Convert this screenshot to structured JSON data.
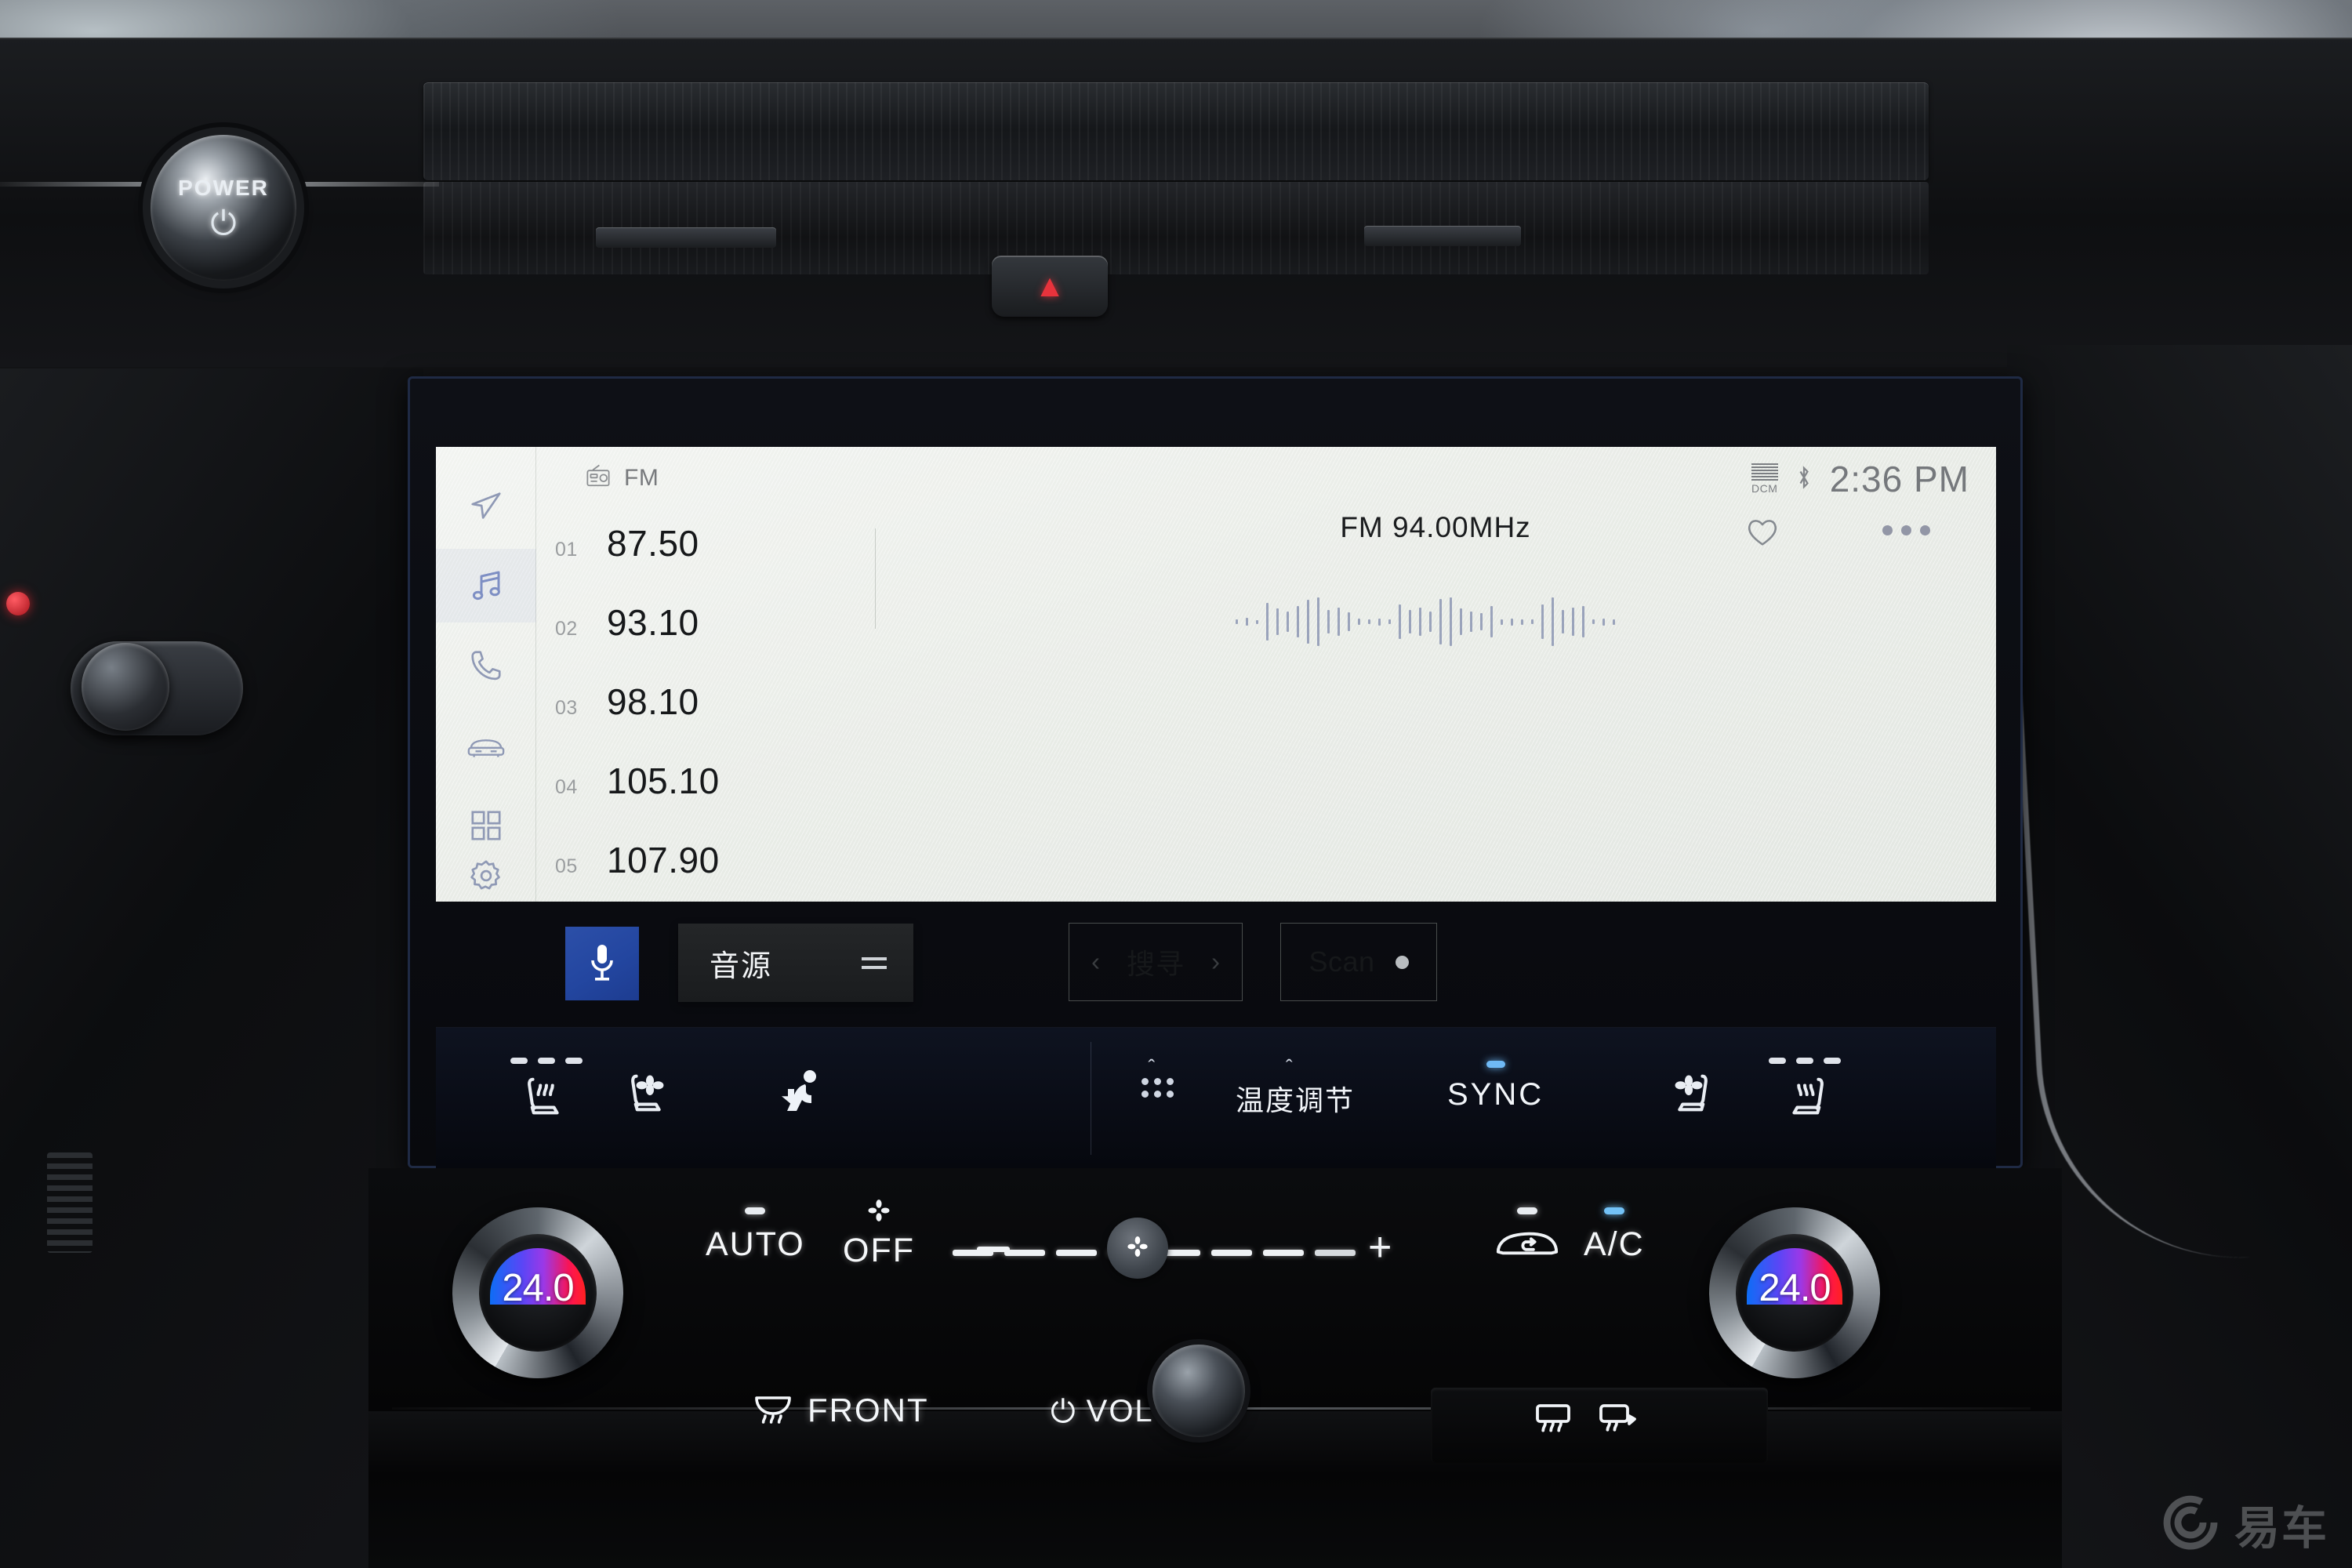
{
  "screen": {
    "statusbar": {
      "source_icon": "radio-icon",
      "source_label": "FM",
      "signal_label": "DCM",
      "bluetooth_icon": "bluetooth-icon",
      "time": "2:36 PM"
    },
    "rail": [
      {
        "name": "navigation",
        "icon": "navigation-arrow-icon",
        "active": false
      },
      {
        "name": "media",
        "icon": "music-note-icon",
        "active": true
      },
      {
        "name": "phone",
        "icon": "phone-icon",
        "active": false
      },
      {
        "name": "vehicle",
        "icon": "car-icon",
        "active": false
      },
      {
        "name": "apps",
        "icon": "apps-grid-icon",
        "active": false
      },
      {
        "name": "settings",
        "icon": "gear-icon",
        "active": false
      }
    ],
    "presets": [
      {
        "num": "01",
        "freq": "87.50"
      },
      {
        "num": "02",
        "freq": "93.10"
      },
      {
        "num": "03",
        "freq": "98.10"
      },
      {
        "num": "04",
        "freq": "105.10"
      },
      {
        "num": "05",
        "freq": "107.90"
      }
    ],
    "now_playing": "FM  94.00MHz",
    "favorite_icon": "heart-outline-icon",
    "more_icon": "more-options-icon",
    "waveform_icon": "audio-waveform",
    "actions": {
      "mic_icon": "microphone-icon",
      "source_label": "音源",
      "source_menu_icon": "hamburger-menu-icon",
      "seek_prev_icon": "chevron-left-icon",
      "seek_label": "搜寻",
      "seek_next_icon": "chevron-right-icon",
      "scan_label": "Scan",
      "scan_indicator": "off"
    }
  },
  "climate_bar": {
    "left_seat_heat": {
      "icon": "seat-heater-icon",
      "dots": 3,
      "dots_on": 3
    },
    "left_seat_vent": {
      "icon": "seat-ventilation-icon"
    },
    "airflow_mode": {
      "icon": "airflow-body-icon",
      "tick": "^"
    },
    "mode_grid": {
      "icon": "airflow-grid-icon",
      "tick": "^"
    },
    "temp_label": "温度调节",
    "sync_label": "SYNC",
    "sync_on": true,
    "right_seat_vent": {
      "icon": "seat-ventilation-icon"
    },
    "right_seat_heat": {
      "icon": "seat-heater-icon",
      "dots": 3,
      "dots_on": 3
    }
  },
  "hvac_panel": {
    "left_temp": "24.0",
    "right_temp": "24.0",
    "auto_label": "AUTO",
    "auto_on": true,
    "fan_off_label": "OFF",
    "fan_off_icon": "fan-icon",
    "minus_icon": "minus-icon",
    "fan_slider_icon": "fan-icon",
    "fan_level": 2,
    "fan_segments": 8,
    "plus_icon": "plus-icon",
    "recirculation_icon": "air-recirculation-icon",
    "recirculation_on": true,
    "ac_label": "A/C",
    "ac_on": true
  },
  "bottom_row": {
    "front_defrost_icon": "front-defrost-icon",
    "front_defrost_label": "FRONT",
    "power_icon": "power-icon",
    "volume_label": "VOL",
    "volume_knob": "volume-knob",
    "rear_defrost_icon": "rear-defrost-icon",
    "mirror_defrost_icon": "mirror-defrost-icon"
  },
  "dashboard": {
    "power_button_label": "POWER",
    "power_button_icon": "power-icon",
    "brand_trim_text": "",
    "hazard_icon": "hazard-triangle-icon"
  },
  "watermark": {
    "logo_icon": "yiche-logo-icon",
    "text": "易车"
  },
  "colors": {
    "accent_blue": "#2c4fa8",
    "sync_blue": "#6fb9f5",
    "screen_bg": "#e9ece7",
    "climate_bg": "#0a0d17",
    "hazard_red": "#e8333c"
  }
}
